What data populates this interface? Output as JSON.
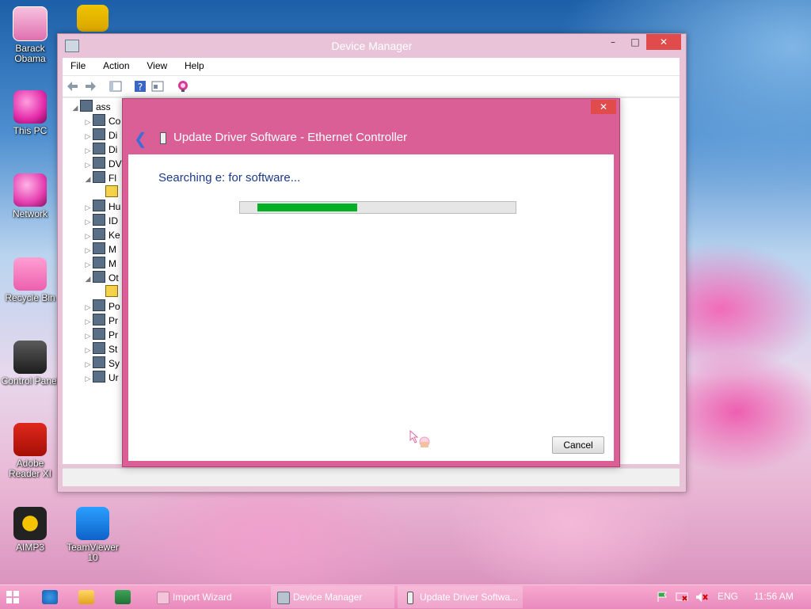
{
  "desktop": {
    "icons": [
      {
        "label": "Barack\nObama",
        "icon": "doll-icon"
      },
      {
        "label": "This PC",
        "icon": "this-pc-icon"
      },
      {
        "label": "Network",
        "icon": "network-icon"
      },
      {
        "label": "Recycle Bin",
        "icon": "recycle-bin-icon"
      },
      {
        "label": "Control Panel",
        "icon": "control-panel-icon"
      },
      {
        "label": "Adobe Reader XI",
        "icon": "adobe-reader-icon"
      },
      {
        "label": "AIMP3",
        "icon": "aimp-icon"
      },
      {
        "label": "TeamViewer 10",
        "icon": "teamviewer-icon"
      }
    ]
  },
  "device_manager": {
    "title": "Device Manager",
    "controls": {
      "minimize": "–",
      "maximize": "□",
      "close": "✕"
    },
    "menu": [
      "File",
      "Action",
      "View",
      "Help"
    ],
    "tree": [
      {
        "label": "ass",
        "expanded": true,
        "level": 0
      },
      {
        "label": "Co",
        "level": 1
      },
      {
        "label": "Di",
        "level": 1
      },
      {
        "label": "Di",
        "level": 1
      },
      {
        "label": "DV",
        "level": 1
      },
      {
        "label": "Fl",
        "expanded": true,
        "level": 1
      },
      {
        "label": "",
        "level": 2
      },
      {
        "label": "Hu",
        "level": 1
      },
      {
        "label": "ID",
        "level": 1
      },
      {
        "label": "Ke",
        "level": 1
      },
      {
        "label": "M",
        "level": 1
      },
      {
        "label": "M",
        "level": 1
      },
      {
        "label": "Ot",
        "expanded": true,
        "level": 1
      },
      {
        "label": "",
        "level": 2
      },
      {
        "label": "Po",
        "level": 1
      },
      {
        "label": "Pr",
        "level": 1
      },
      {
        "label": "Pr",
        "level": 1
      },
      {
        "label": "St",
        "level": 1
      },
      {
        "label": "Sy",
        "level": 1
      },
      {
        "label": "Ur",
        "level": 1
      }
    ]
  },
  "update_driver": {
    "close": "✕",
    "title": "Update Driver Software - Ethernet Controller",
    "status": "Searching e: for software...",
    "progress": 0.39,
    "cancel_label": "Cancel"
  },
  "taskbar": {
    "tasks": [
      {
        "label": "Import Wizard"
      },
      {
        "label": "Device Manager"
      },
      {
        "label": "Update Driver Softwa..."
      }
    ],
    "language": "ENG",
    "time": "11:56 AM"
  }
}
